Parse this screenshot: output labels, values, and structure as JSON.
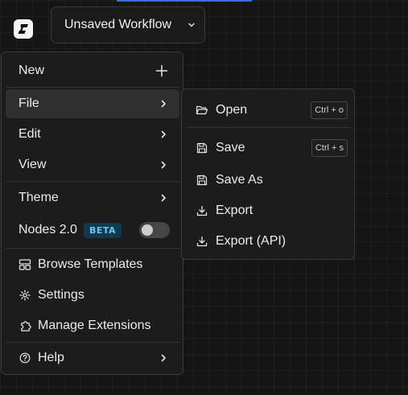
{
  "header": {
    "workflow_title": "Unsaved Workflow"
  },
  "menu": {
    "new_label": "New",
    "file_label": "File",
    "edit_label": "Edit",
    "view_label": "View",
    "theme_label": "Theme",
    "nodes_label": "Nodes 2.0",
    "nodes_badge": "BETA",
    "nodes_enabled": false,
    "browse_templates_label": "Browse Templates",
    "settings_label": "Settings",
    "manage_extensions_label": "Manage Extensions",
    "help_label": "Help"
  },
  "file_submenu": {
    "open_label": "Open",
    "open_shortcut": "Ctrl + o",
    "save_label": "Save",
    "save_shortcut": "Ctrl + s",
    "save_as_label": "Save As",
    "export_label": "Export",
    "export_api_label": "Export (API)"
  },
  "colors": {
    "accent": "#3b6ed8",
    "beta_text": "#6ec4ef",
    "beta_bg": "#123a4e"
  }
}
